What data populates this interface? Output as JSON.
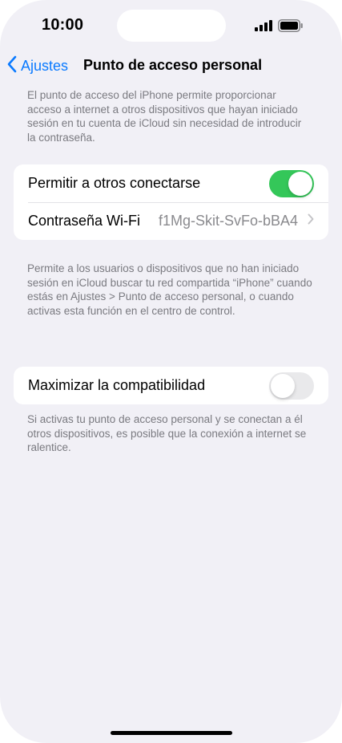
{
  "status_bar": {
    "time": "10:00",
    "signal_icon": "signal-icon",
    "battery_icon": "battery-icon"
  },
  "nav": {
    "back_label": "Ajustes",
    "back_icon": "chevron-left-icon",
    "title": "Punto de acceso personal"
  },
  "intro_text": "El punto de acceso del iPhone permite proporcionar acceso a internet a otros dispositivos que hayan iniciado sesión en tu cuenta de iCloud sin necesidad de introducir la contraseña.",
  "group1": {
    "allow_label": "Permitir a otros conectarse",
    "allow_on": true,
    "wifi_label": "Contraseña Wi-Fi",
    "wifi_value": "f1Mg-Skit-SvFo-bBA4"
  },
  "group1_footer": "Permite a los usuarios o dispositivos que no han iniciado sesión en iCloud buscar tu red compartida “iPhone” cuando estás en Ajustes > Punto de acceso personal, o cuando activas esta función en el centro de control.",
  "group2": {
    "maximize_label": "Maximizar la compatibilidad",
    "maximize_on": false
  },
  "group2_footer": "Si activas tu punto de acceso personal y se conectan a él otros dispositivos, es posible que la conexión a internet se ralentice.",
  "colors": {
    "accent": "#0a7aff",
    "toggle_on": "#34c759",
    "toggle_off": "#e9e9eb",
    "background": "#f1f0f6"
  }
}
